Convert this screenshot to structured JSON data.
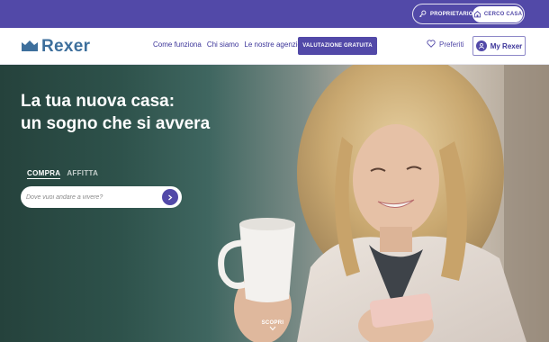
{
  "topbar": {
    "owner_label": "PROPRIETARIO",
    "search_home_label": "CERCO CASA"
  },
  "navbar": {
    "logo_text": "Rexer",
    "links": [
      "Come funziona",
      "Chi siamo",
      "Le nostre agenzie"
    ],
    "cta_label": "VALUTAZIONE GRATUITA",
    "favorites_label": "Preferiti",
    "account_label": "My Rexer"
  },
  "hero": {
    "title_line1": "La tua nuova casa:",
    "title_line2": "un sogno che si avvera",
    "tabs": [
      "COMPRA",
      "AFFITTA"
    ],
    "active_tab": "COMPRA",
    "search_placeholder": "Dove vuoi andare a vivere?",
    "discover_label": "SCOPRI"
  },
  "colors": {
    "brand_purple": "#5249a8",
    "logo_blue": "#3d6f9c"
  },
  "icons": [
    "key-icon",
    "house-icon",
    "crown-logo-icon",
    "heart-icon",
    "user-icon",
    "arrow-right-icon",
    "chevron-down-icon"
  ]
}
